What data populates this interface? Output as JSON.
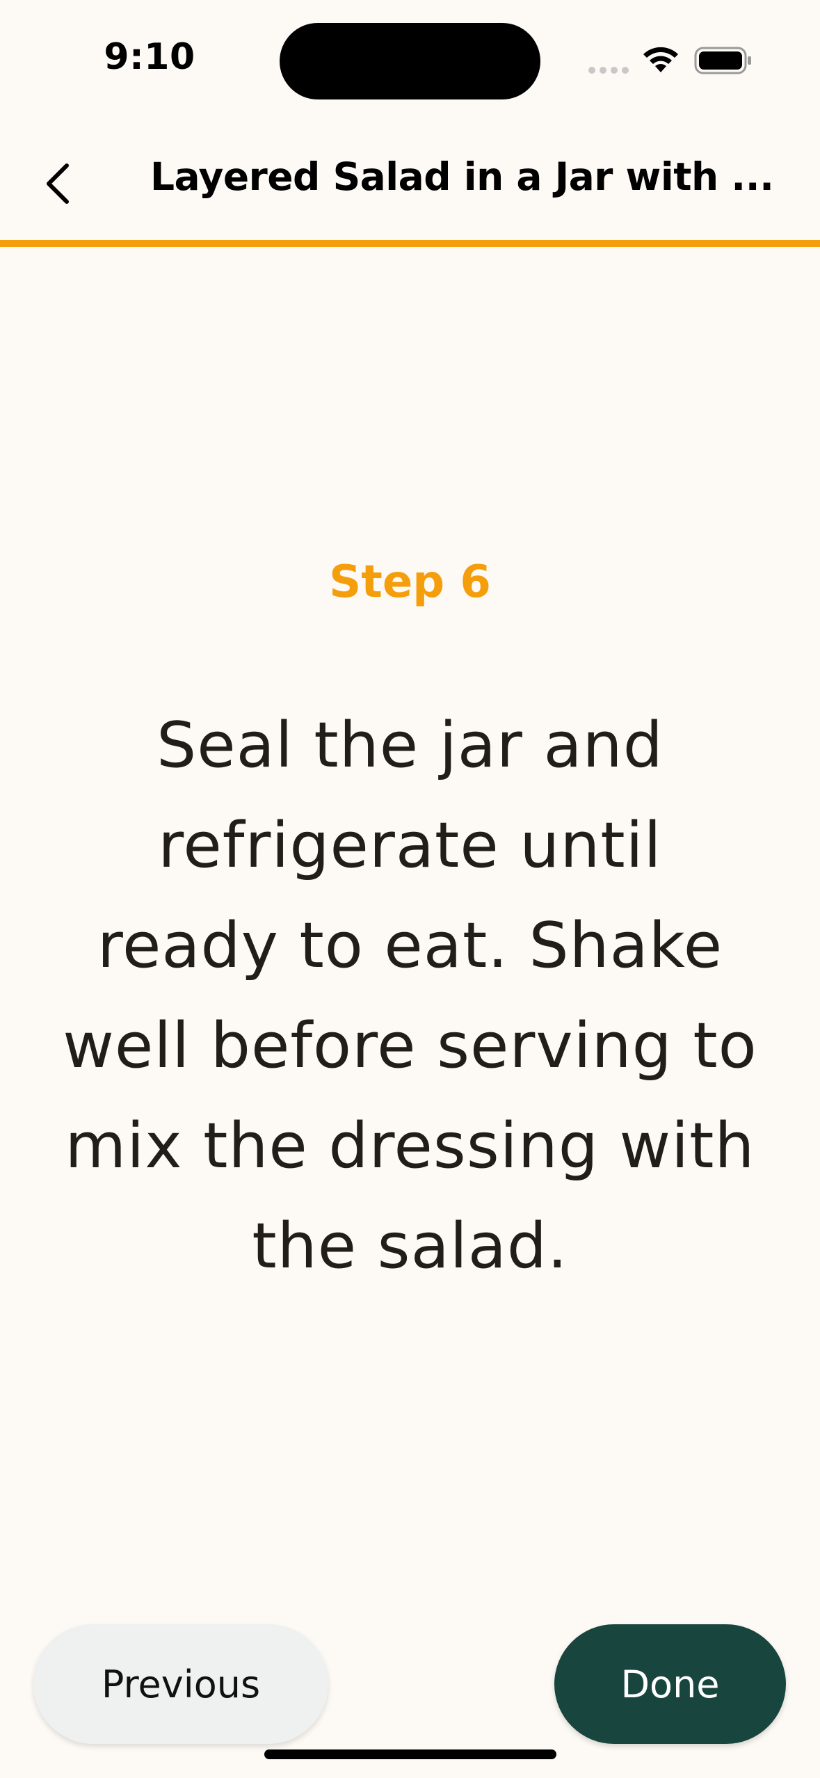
{
  "status_bar": {
    "time": "9:10"
  },
  "header": {
    "back_icon": "chevron-left-icon",
    "title": "Layered Salad in a Jar with ..."
  },
  "progress": {
    "value": 1.0,
    "color": "#f59e0b"
  },
  "step": {
    "label": "Step 6",
    "text": "Seal the jar and refrigerate until ready to eat. Shake well before serving to mix the dressing with the salad."
  },
  "footer": {
    "previous_label": "Previous",
    "done_label": "Done"
  },
  "colors": {
    "background": "#fdf9f5",
    "accent": "#f59e0b",
    "done_button": "#18453d",
    "previous_button": "#eff0f0"
  }
}
